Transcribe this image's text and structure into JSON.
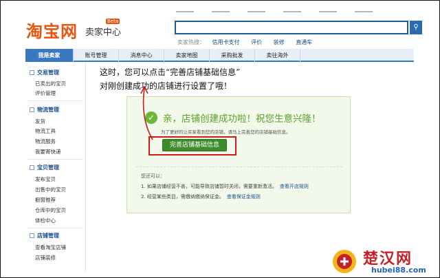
{
  "header": {
    "logo": "淘宝网",
    "logo_sub": "卖家中心",
    "beta": "Beta",
    "search_button": "",
    "hot_label": "卖家热搜：",
    "hot_items": [
      "信用卡支付",
      "评价",
      "装修",
      "直通车"
    ]
  },
  "nav": {
    "tabs": [
      "我是卖家",
      "账号管理",
      "消息中心",
      "卖家地图",
      "采购批发",
      "卖往海外"
    ]
  },
  "sidebar": {
    "sections": [
      {
        "title": "交易管理",
        "items": [
          "已卖出的宝贝",
          "评价管理"
        ]
      },
      {
        "title": "物流管理",
        "items": [
          "发货",
          "物流工具",
          "物流服务",
          "我要寄快递"
        ]
      },
      {
        "title": "宝贝管理",
        "items": [
          "发布宝贝",
          "出售中的宝贝",
          "橱窗推荐",
          "仓库中的宝贝",
          "体检中心"
        ]
      },
      {
        "title": "店铺管理",
        "items": [
          "查看淘宝店铺",
          "店铺装修"
        ]
      }
    ]
  },
  "annotation": {
    "line1": "这时，您可以点击“完善店铺基础信息”",
    "line2": "对刚创建成功的店铺进行设置了哦！"
  },
  "main": {
    "success_title": "亲，店铺创建成功啦！祝您生意兴隆！",
    "tip": "为了更好的让买家看到您的店铺，请马上完善您的店铺基础信息。",
    "button": "完善店铺基础信息",
    "also_label": "您还可以：",
    "notes": [
      {
        "text": "1. 如果店铺经营不善，可能导致店铺暂时关闭，需要重新激活。",
        "link": "查看开店规则"
      },
      {
        "text": "2. 经营某些类目，需缴纳缴纳保证金。",
        "link": "查看保证金规则"
      }
    ]
  },
  "watermark": {
    "name": "楚汉网",
    "url": "hubei88.com"
  },
  "colors": {
    "brand_orange": "#e8530e",
    "nav_blue": "#3a78c0",
    "success_green": "#58a22a",
    "button_green": "#3d8b2a",
    "highlight_red": "#d01818"
  }
}
